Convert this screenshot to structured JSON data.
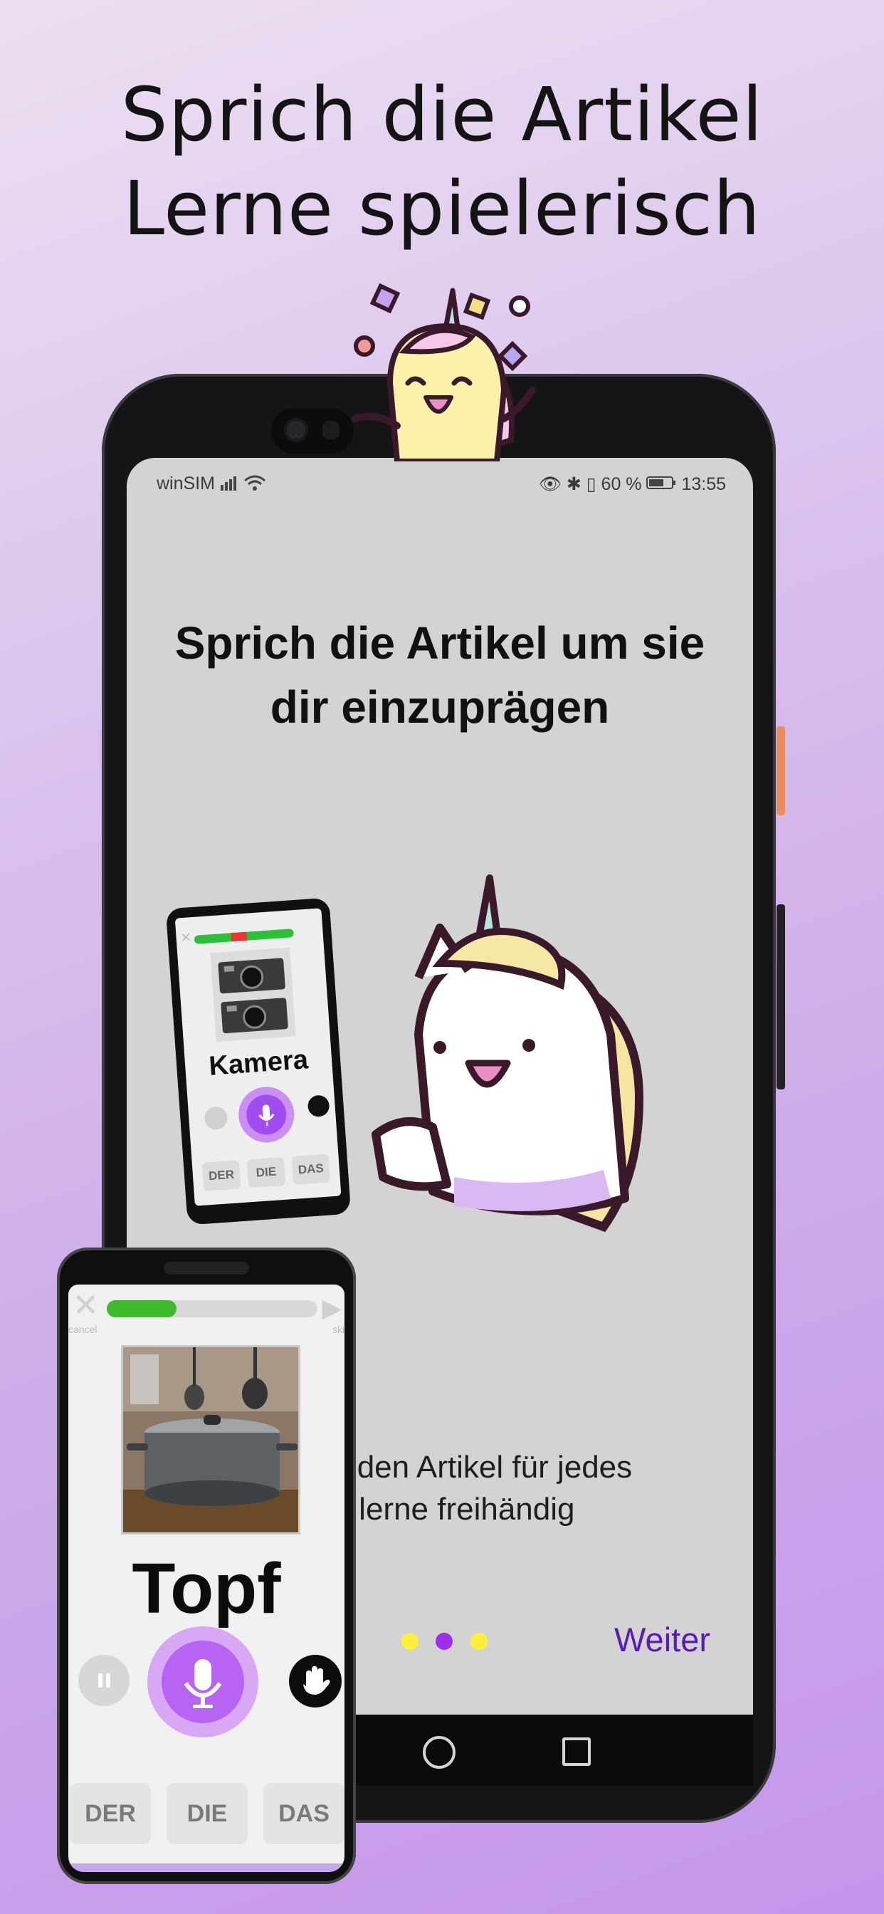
{
  "headline": {
    "line1": "Sprich die Artikel",
    "line2": "Lerne spielerisch"
  },
  "status_bar": {
    "carrier": "winSIM",
    "battery": "60 %",
    "time": "13:55"
  },
  "screen": {
    "title_line1": "Sprich die Artikel um sie",
    "title_line2": "dir einzuprägen",
    "body_line1": "ch den Artikel für jedes",
    "body_line2": "nd lerne freihändig",
    "next_button": "Weiter",
    "page_dots": [
      "#ffef3a",
      "#9b2ff0",
      "#ffef3a"
    ]
  },
  "mini_phone": {
    "word": "Kamera",
    "articles": [
      "DER",
      "DIE",
      "DAS"
    ]
  },
  "front_phone": {
    "cancel_label": "cancel",
    "skip_label": "ski",
    "progress": 0.33,
    "word": "Topf",
    "articles": [
      "DER",
      "DIE",
      "DAS"
    ]
  },
  "colors": {
    "accent_purple": "#b764f4",
    "link_purple": "#5a1bb2",
    "progress_green": "#3dbb2a",
    "background_lavender": "#cfaee9"
  },
  "icons": [
    "microphone-icon",
    "pause-icon",
    "hand-icon",
    "close-icon",
    "skip-icon",
    "wifi-icon",
    "signal-icon",
    "eye-icon",
    "bluetooth-icon",
    "vibrate-icon",
    "battery-icon",
    "unicorn-mascot",
    "camera-photo",
    "pot-photo"
  ]
}
